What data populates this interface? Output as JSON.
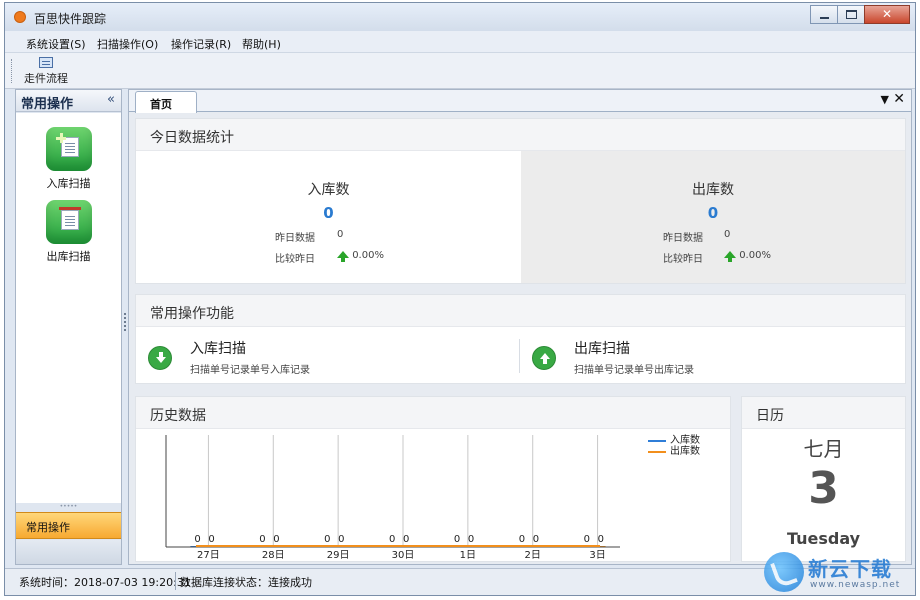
{
  "window": {
    "title": "百思快件跟踪"
  },
  "menu": [
    "系统设置(S)",
    "扫描操作(O)",
    "操作记录(R)",
    "帮助(H)"
  ],
  "toolbar": {
    "flow_label": "走件流程"
  },
  "sidebar": {
    "title": "常用操作",
    "collapse_glyph": "«",
    "ops": [
      {
        "label": "入库扫描",
        "icon": "inbound-scan-icon"
      },
      {
        "label": "出库扫描",
        "icon": "outbound-scan-icon"
      }
    ],
    "active_tab": "常用操作"
  },
  "tabs": {
    "home_label": "首页"
  },
  "stats": {
    "title": "今日数据统计",
    "inbound": {
      "name": "入库数",
      "value": "0",
      "yesterday_label": "昨日数据",
      "yesterday_value": "0",
      "compare_label": "比较昨日",
      "compare_value": "0.00%"
    },
    "outbound": {
      "name": "出库数",
      "value": "0",
      "yesterday_label": "昨日数据",
      "yesterday_value": "0",
      "compare_label": "比较昨日",
      "compare_value": "0.00%"
    }
  },
  "functions": {
    "title": "常用操作功能",
    "items": [
      {
        "title": "入库扫描",
        "desc": "扫描单号记录单号入库记录",
        "icon": "download-arrow-icon"
      },
      {
        "title": "出库扫描",
        "desc": "扫描单号记录单号出库记录",
        "icon": "upload-arrow-icon"
      }
    ]
  },
  "history": {
    "title": "历史数据"
  },
  "chart_data": {
    "type": "bar",
    "categories": [
      "27日",
      "28日",
      "29日",
      "30日",
      "1日",
      "2日",
      "3日"
    ],
    "series": [
      {
        "name": "入库数",
        "values": [
          0,
          0,
          0,
          0,
          0,
          0,
          0
        ],
        "color": "#2f7ed8"
      },
      {
        "name": "出库数",
        "values": [
          0,
          0,
          0,
          0,
          0,
          0,
          0
        ],
        "color": "#f28f1c"
      }
    ],
    "data_labels": true,
    "legend": "top-right",
    "grid": true
  },
  "calendar": {
    "title": "日历",
    "month": "七月",
    "day": "3",
    "weekday": "Tuesday"
  },
  "status": {
    "time_text": "系统时间：2018-07-03 19:20:31",
    "db_text": "数据库连接状态：连接成功"
  },
  "watermark": {
    "text": "新云下载",
    "url": "www.newasp.net"
  }
}
